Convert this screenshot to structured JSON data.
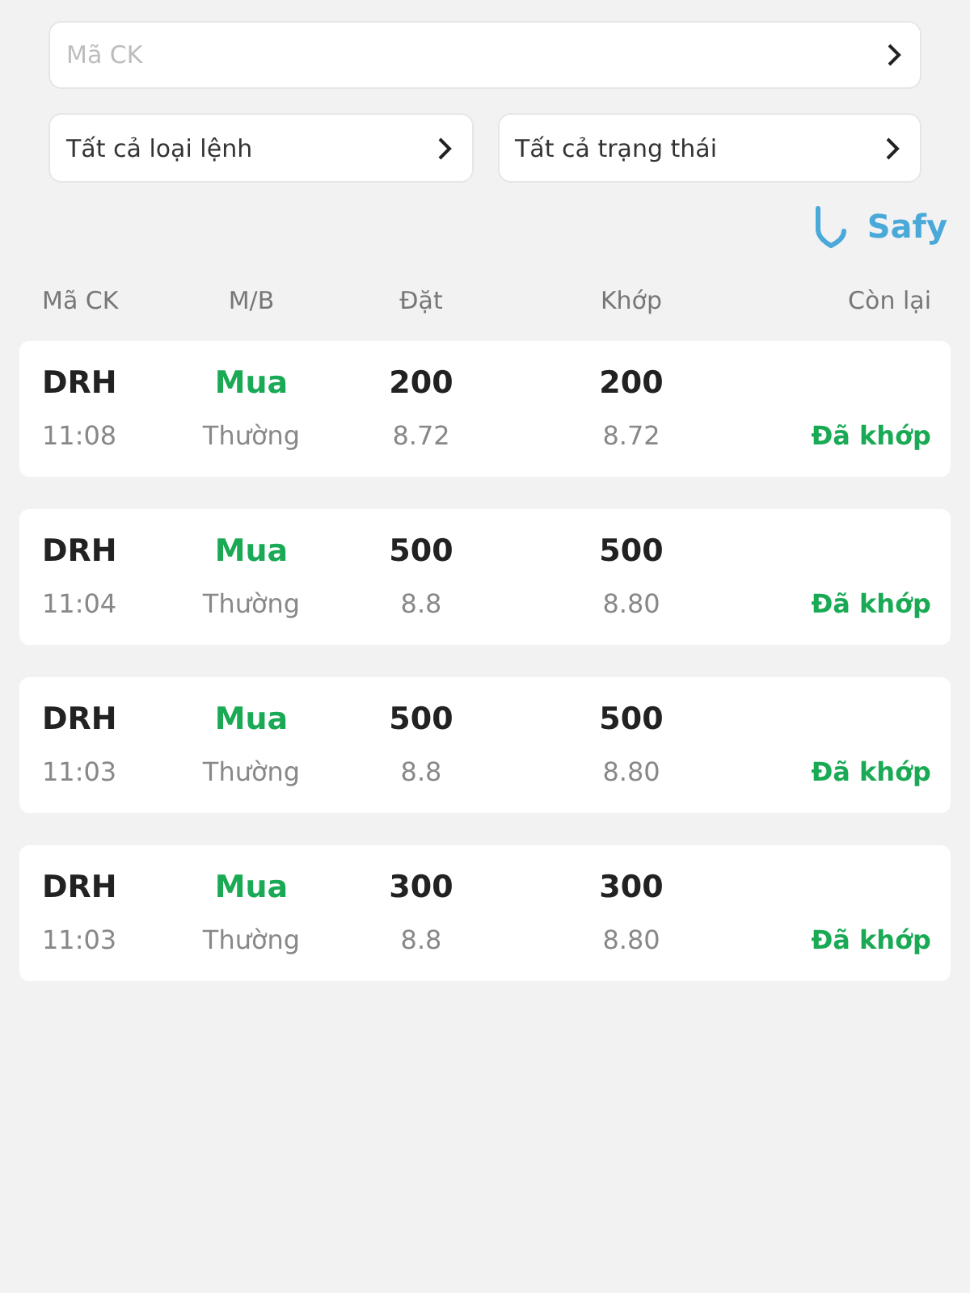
{
  "search": {
    "placeholder": "Mã CK"
  },
  "filters": [
    {
      "label": "Tất cả loại lệnh"
    },
    {
      "label": "Tất cả trạng thái"
    }
  ],
  "logo": {
    "text": "Safy"
  },
  "table": {
    "columns": [
      "Mã CK",
      "M/B",
      "Đặt",
      "Khớp",
      "Còn lại"
    ],
    "rows": [
      {
        "symbol": "DRH",
        "time": "11:08",
        "side": {
          "text": "Mua",
          "color": "#1aaa55"
        },
        "order_type": "Thường",
        "ordered_qty": "200",
        "ordered_price": "8.72",
        "matched_qty": "200",
        "matched_price": "8.72",
        "status": {
          "text": "Đã khớp",
          "color": "#1aaa55"
        }
      },
      {
        "symbol": "DRH",
        "time": "11:04",
        "side": {
          "text": "Mua",
          "color": "#1aaa55"
        },
        "order_type": "Thường",
        "ordered_qty": "500",
        "ordered_price": "8.8",
        "matched_qty": "500",
        "matched_price": "8.80",
        "status": {
          "text": "Đã khớp",
          "color": "#1aaa55"
        }
      },
      {
        "symbol": "DRH",
        "time": "11:03",
        "side": {
          "text": "Mua",
          "color": "#1aaa55"
        },
        "order_type": "Thường",
        "ordered_qty": "500",
        "ordered_price": "8.8",
        "matched_qty": "500",
        "matched_price": "8.80",
        "status": {
          "text": "Đã khớp",
          "color": "#1aaa55"
        }
      },
      {
        "symbol": "DRH",
        "time": "11:03",
        "side": {
          "text": "Mua",
          "color": "#1aaa55"
        },
        "order_type": "Thường",
        "ordered_qty": "300",
        "ordered_price": "8.8",
        "matched_qty": "300",
        "matched_price": "8.80",
        "status": {
          "text": "Đã khớp",
          "color": "#1aaa55"
        }
      }
    ]
  }
}
